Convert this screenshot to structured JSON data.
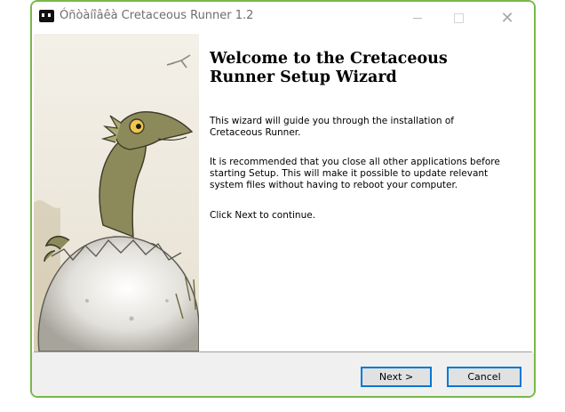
{
  "window": {
    "title": "Óñòàíîâêà Cretaceous Runner 1.2",
    "border_color": "#79b84a"
  },
  "titlebar_controls": {
    "minimize": "—",
    "close": "✕"
  },
  "side_image": {
    "icon": "dinosaur-hatching-illustration"
  },
  "content": {
    "heading": "Welcome to the Cretaceous\nRunner Setup Wizard",
    "paragraph1": "This wizard will guide you through the installation of\nCretaceous Runner.",
    "paragraph2": "It is recommended that you close all other applications before\nstarting Setup. This will make it possible to update relevant\nsystem files without having to reboot your computer.",
    "paragraph3": "Click Next to continue."
  },
  "footer": {
    "next_label": "Next >",
    "cancel_label": "Cancel"
  },
  "colors": {
    "accent": "#0078d7",
    "footer_bg": "#f0f0f0"
  }
}
